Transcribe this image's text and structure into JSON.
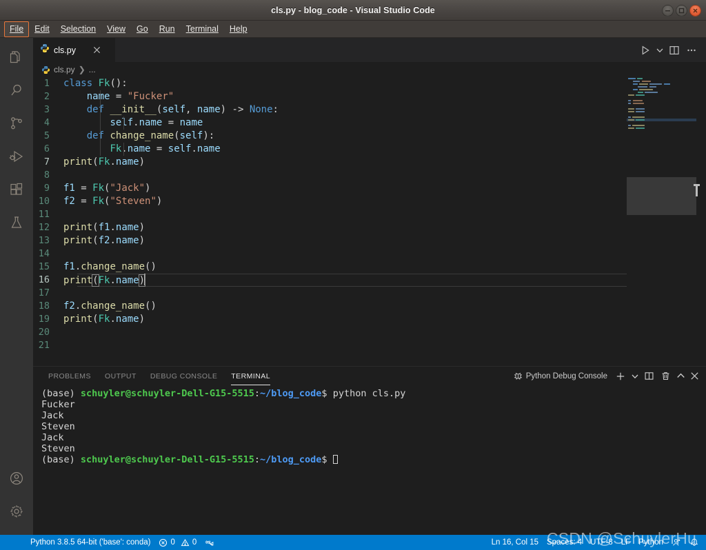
{
  "window": {
    "title": "cls.py - blog_code - Visual Studio Code",
    "controls": {
      "minimize": "minimize-button",
      "maximize": "maximize-button",
      "close": "close-button"
    }
  },
  "menubar": {
    "items": [
      {
        "label": "File",
        "mnemonic": "F",
        "focused": true
      },
      {
        "label": "Edit",
        "mnemonic": "E",
        "focused": false
      },
      {
        "label": "Selection",
        "mnemonic": "S",
        "focused": false
      },
      {
        "label": "View",
        "mnemonic": "V",
        "focused": false
      },
      {
        "label": "Go",
        "mnemonic": "G",
        "focused": false
      },
      {
        "label": "Run",
        "mnemonic": "R",
        "focused": false
      },
      {
        "label": "Terminal",
        "mnemonic": "T",
        "focused": false
      },
      {
        "label": "Help",
        "mnemonic": "H",
        "focused": false
      }
    ]
  },
  "activitybar": {
    "items": [
      {
        "name": "explorer",
        "icon": "files-icon"
      },
      {
        "name": "search",
        "icon": "search-icon"
      },
      {
        "name": "source-control",
        "icon": "source-control-icon"
      },
      {
        "name": "run-and-debug",
        "icon": "run-debug-icon"
      },
      {
        "name": "extensions",
        "icon": "extensions-icon"
      },
      {
        "name": "testing",
        "icon": "beaker-icon"
      }
    ],
    "bottom": [
      {
        "name": "account",
        "icon": "account-icon"
      },
      {
        "name": "manage",
        "icon": "gear-icon"
      }
    ]
  },
  "editor": {
    "tab": {
      "label": "cls.py",
      "icon": "python-file-icon",
      "close": "×",
      "dirty": false
    },
    "actions": [
      {
        "name": "run-python-file",
        "icon": "play-icon"
      },
      {
        "name": "run-options",
        "icon": "chevron-down-icon"
      },
      {
        "name": "split-editor-right",
        "icon": "split-editor-icon"
      },
      {
        "name": "more-actions",
        "icon": "ellipsis-icon"
      }
    ],
    "breadcrumb": {
      "file": "cls.py",
      "separator": "❯",
      "more": "..."
    },
    "language": "python",
    "lines": [
      {
        "n": 1,
        "text": "class Fk():"
      },
      {
        "n": 2,
        "text": "    name = \"Fucker\""
      },
      {
        "n": 3,
        "text": "    def __init__(self, name) -> None:"
      },
      {
        "n": 4,
        "text": "        self.name = name"
      },
      {
        "n": 5,
        "text": "    def change_name(self):"
      },
      {
        "n": 6,
        "text": "        Fk.name = self.name"
      },
      {
        "n": 7,
        "text": "print(Fk.name)"
      },
      {
        "n": 8,
        "text": ""
      },
      {
        "n": 9,
        "text": "f1 = Fk(\"Jack\")"
      },
      {
        "n": 10,
        "text": "f2 = Fk(\"Steven\")"
      },
      {
        "n": 11,
        "text": ""
      },
      {
        "n": 12,
        "text": "print(f1.name)"
      },
      {
        "n": 13,
        "text": "print(f2.name)"
      },
      {
        "n": 14,
        "text": ""
      },
      {
        "n": 15,
        "text": "f1.change_name()"
      },
      {
        "n": 16,
        "text": "print(Fk.name)"
      },
      {
        "n": 17,
        "text": ""
      },
      {
        "n": 18,
        "text": "f2.change_name()"
      },
      {
        "n": 19,
        "text": "print(Fk.name)"
      },
      {
        "n": 20,
        "text": ""
      },
      {
        "n": 21,
        "text": ""
      }
    ],
    "active_line": 16,
    "cursor": {
      "line": 16,
      "column": 15
    }
  },
  "panel": {
    "tabs": [
      {
        "label": "Problems",
        "active": false
      },
      {
        "label": "Output",
        "active": false
      },
      {
        "label": "Debug Console",
        "active": false
      },
      {
        "label": "Terminal",
        "active": true
      }
    ],
    "selected_terminal": "Python Debug Console",
    "selected_terminal_icon": "debug-console-icon",
    "actions": [
      {
        "name": "new-terminal",
        "icon": "plus-icon"
      },
      {
        "name": "terminal-dropdown",
        "icon": "chevron-down-icon"
      },
      {
        "name": "split-terminal",
        "icon": "split-panel-icon"
      },
      {
        "name": "kill-terminal",
        "icon": "trash-icon"
      },
      {
        "name": "maximize-panel",
        "icon": "chevron-up-icon"
      },
      {
        "name": "close-panel",
        "icon": "close-icon"
      }
    ],
    "terminal": {
      "prompt": {
        "env": "(base) ",
        "user": "schuyler@schuyler-Dell-G15-5515",
        "colon": ":",
        "path": "~/blog_code",
        "sigil": "$ "
      },
      "lines": [
        {
          "type": "prompt",
          "command": "python cls.py"
        },
        {
          "type": "out",
          "text": "Fucker"
        },
        {
          "type": "out",
          "text": "Jack"
        },
        {
          "type": "out",
          "text": "Steven"
        },
        {
          "type": "out",
          "text": "Jack"
        },
        {
          "type": "out",
          "text": "Steven"
        },
        {
          "type": "prompt",
          "command": "",
          "cursor": true
        }
      ]
    }
  },
  "statusbar": {
    "left": [
      {
        "name": "python-interpreter",
        "label": "Python 3.8.5 64-bit ('base': conda)"
      },
      {
        "name": "problems-counts",
        "errors": "0",
        "warnings": "0"
      },
      {
        "name": "remote-tunnel",
        "label": ""
      }
    ],
    "right": [
      {
        "name": "editor-position",
        "label": "Ln 16, Col 15"
      },
      {
        "name": "indentation",
        "label": "Spaces: 4"
      },
      {
        "name": "encoding",
        "label": "UTF-8"
      },
      {
        "name": "eol",
        "label": "LF"
      },
      {
        "name": "language-mode",
        "label": "Python"
      },
      {
        "name": "accounts",
        "icon": "account-icon"
      },
      {
        "name": "notifications",
        "icon": "bell-icon"
      }
    ],
    "accent": "#007acc"
  },
  "watermark": {
    "text": "CSDN @SchuylerHu"
  },
  "colors": {
    "editor_bg": "#1e1e1e",
    "sidebar_bg": "#333333",
    "tabbar_bg": "#252526",
    "titlebar_bg": "#403c39",
    "status_accent": "#007acc",
    "menu_focus": "#e8763a",
    "keyword": "#569cd6",
    "class": "#4ec9b0",
    "function": "#dcdcaa",
    "string": "#ce9178",
    "variable": "#9cdcfe",
    "linenumber": "#5a8a7a",
    "terminal_green": "#4ec94e",
    "terminal_blue": "#4e9bf5"
  }
}
